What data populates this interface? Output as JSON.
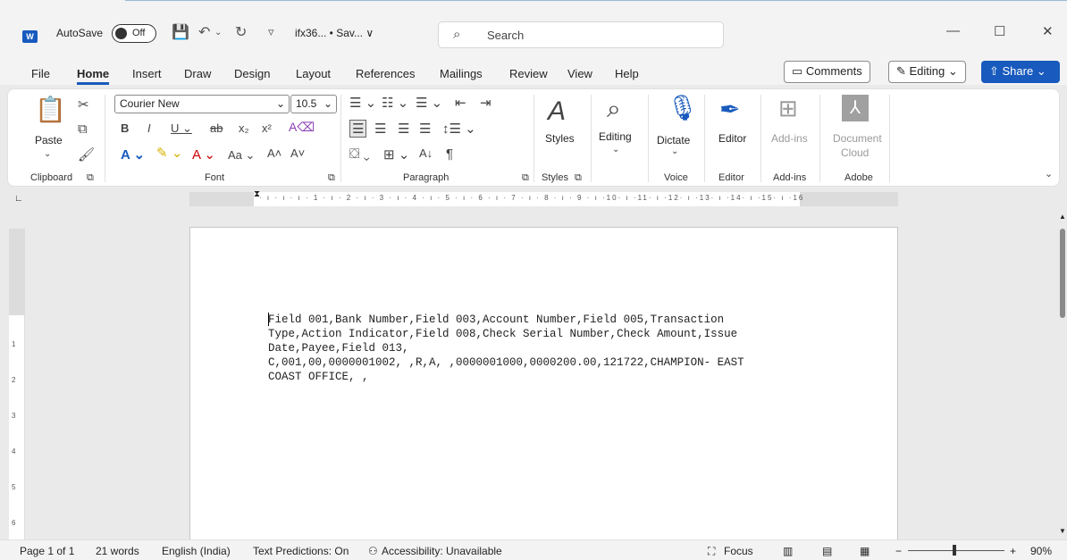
{
  "titlebar": {
    "app_icon": "W",
    "autosave_label": "AutoSave",
    "autosave_state": "Off",
    "filename": "ifx36... • Sav... ∨",
    "search_placeholder": "Search"
  },
  "menu": {
    "tabs": [
      "File",
      "Home",
      "Insert",
      "Draw",
      "Design",
      "Layout",
      "References",
      "Mailings",
      "Review",
      "View",
      "Help"
    ],
    "active_tab": "Home",
    "comments_label": "Comments",
    "editing_label": "Editing",
    "share_label": "Share"
  },
  "ribbon": {
    "clipboard": {
      "paste": "Paste",
      "group": "Clipboard"
    },
    "font": {
      "name": "Courier New",
      "size": "10.5",
      "group": "Font"
    },
    "paragraph": {
      "group": "Paragraph"
    },
    "styles": {
      "label": "Styles",
      "group": "Styles"
    },
    "editing": {
      "label": "Editing"
    },
    "voice": {
      "label": "Dictate",
      "group": "Voice"
    },
    "editor": {
      "label": "Editor",
      "group": "Editor"
    },
    "addins": {
      "label": "Add-ins",
      "group": "Add-ins"
    },
    "adobe": {
      "label1": "Document",
      "label2": "Cloud",
      "group": "Adobe"
    }
  },
  "ruler": {
    "numbers": "· ı · ı · ı · 1 · ı · 2 · ı · 3 · ı · 4 · ı · 5 · ı · 6 · ı · 7 · ı · 8 · ı · 9 · ı ·10· ı ·11· ı ·12· ı ·13· ı ·14· ı ·15· ı ·16",
    "vertical": [
      "1",
      "2",
      "3",
      "4",
      "5",
      "6"
    ]
  },
  "document": {
    "text": "Field 001,Bank Number,Field 003,Account Number,Field 005,Transaction\nType,Action Indicator,Field 008,Check Serial Number,Check Amount,Issue\nDate,Payee,Field 013,\nC,001,00,0000001002, ,R,A, ,0000001000,0000200.00,121722,CHAMPION- EAST\nCOAST OFFICE, ,"
  },
  "status": {
    "page": "Page 1 of 1",
    "words": "21 words",
    "language": "English (India)",
    "predictions": "Text Predictions: On",
    "accessibility": "Accessibility: Unavailable",
    "focus": "Focus",
    "zoom": "90%",
    "zoom_fraction": 0.9
  }
}
